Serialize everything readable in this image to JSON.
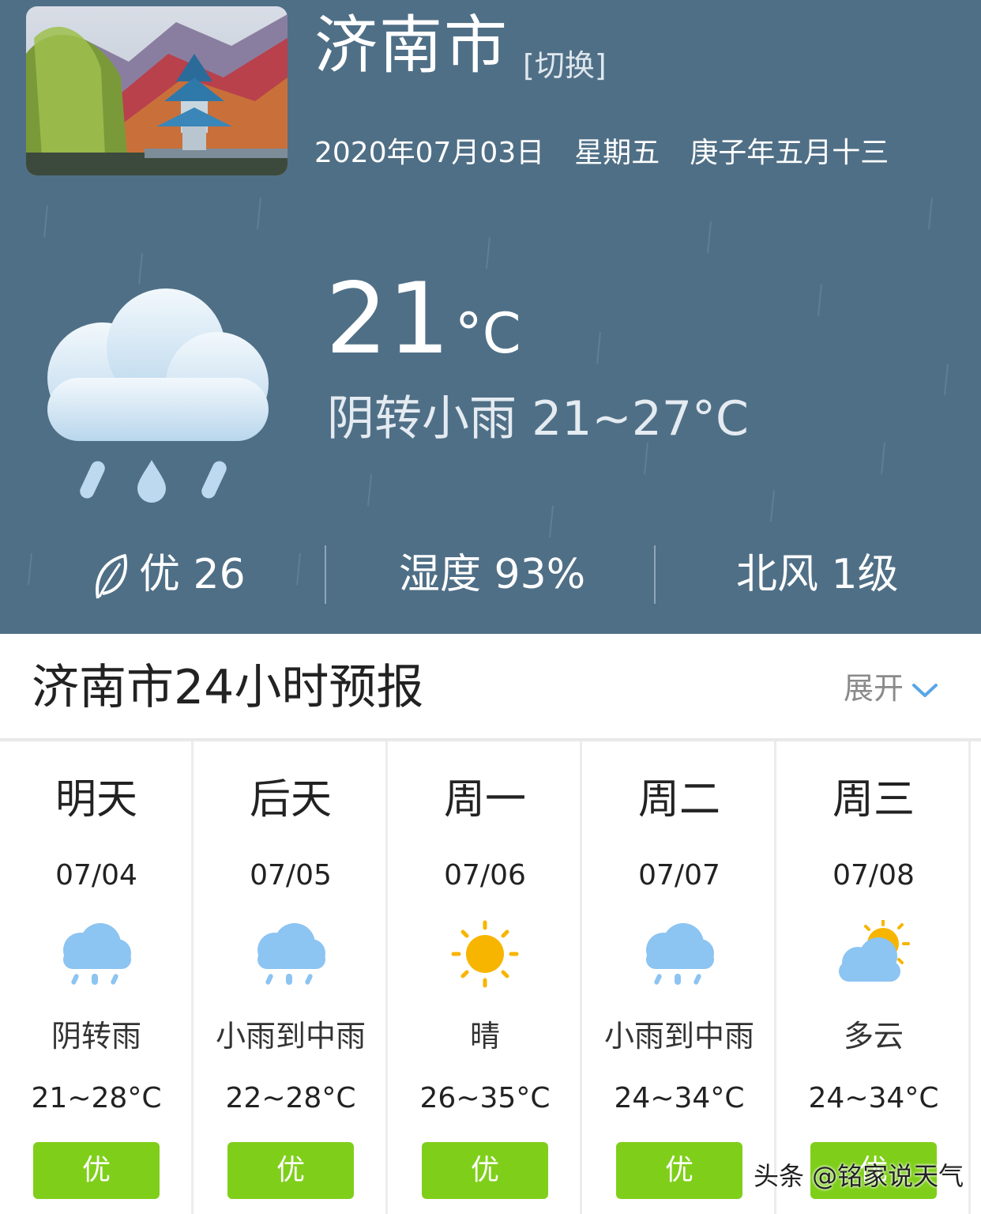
{
  "header": {
    "city": "济南市",
    "switch_label": "[切换]",
    "date": "2020年07月03日",
    "weekday": "星期五",
    "lunar": "庚子年五月十三",
    "thumbnail_icon": "pavilion-landscape-photo"
  },
  "current": {
    "temperature": "21",
    "unit": "°C",
    "condition": "阴转小雨 21~27°C",
    "icon": "cloud-rain-icon",
    "air_quality": "优 26",
    "humidity": "湿度 93%",
    "wind": "北风 1级"
  },
  "forecast": {
    "title": "济南市24小时预报",
    "expand_label": "展开",
    "days": [
      {
        "name": "明天",
        "date": "07/04",
        "icon": "rain-icon",
        "desc": "阴转雨",
        "range": "21~28°C",
        "aq": "优"
      },
      {
        "name": "后天",
        "date": "07/05",
        "icon": "rain-icon",
        "desc": "小雨到中雨",
        "range": "22~28°C",
        "aq": "优"
      },
      {
        "name": "周一",
        "date": "07/06",
        "icon": "sun-icon",
        "desc": "晴",
        "range": "26~35°C",
        "aq": "优"
      },
      {
        "name": "周二",
        "date": "07/07",
        "icon": "rain-icon",
        "desc": "小雨到中雨",
        "range": "24~34°C",
        "aq": "优"
      },
      {
        "name": "周三",
        "date": "07/08",
        "icon": "partly-cloudy-icon",
        "desc": "多云",
        "range": "24~34°C",
        "aq": "优"
      }
    ]
  },
  "colors": {
    "header_bg": "#4f6f86",
    "aq_green": "#7fcf1a",
    "sun": "#f7b500",
    "rain_cloud": "#8cc4f2"
  },
  "watermark": "头条 @铭家说天气"
}
